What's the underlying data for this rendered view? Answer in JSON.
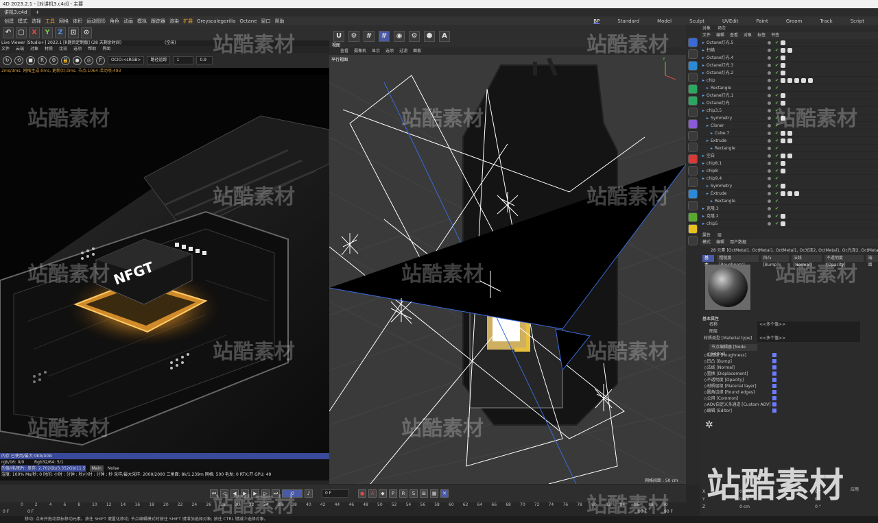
{
  "window": {
    "title": "4D 2023.2.1 - [对讲机3.c4d] - 主要"
  },
  "doc_tab": {
    "label": "讲机3.c4d",
    "plus": "+"
  },
  "menu": [
    "创建",
    "模式",
    "选择",
    "工具",
    "网格",
    "体积",
    "运动图形",
    "角色",
    "动画",
    "模拟",
    "跟踪器",
    "渲染",
    "扩展",
    "Greyscalegorilla",
    "Octane",
    "窗口",
    "帮助"
  ],
  "layouts": [
    "Standard",
    "Model",
    "Sculpt",
    "UVEdit",
    "Paint",
    "Groom",
    "Track",
    "Script"
  ],
  "active_layout": "BP",
  "axis_buttons": [
    "X",
    "Y",
    "Z"
  ],
  "live_viewer": {
    "title": "Live Viewer [Studio+] 2022.1 [R题目定制版] (28 天剩余时间)",
    "right": "(空闲)",
    "menu": [
      "文件",
      "云端",
      "对象",
      "材质",
      "比较",
      "选项",
      "帮助",
      "界面"
    ],
    "ocio": "OCIO:<sRGB>",
    "mode": "路径追踪",
    "val1": "1",
    "val2": "0.9",
    "stat": "2ms/3ms. 网格生成:0ms, 更新(t):0ms. 节点:1064 活动项:493",
    "chip_label": "NFGT"
  },
  "render_stats": {
    "line1": "内存 已使用/最大:0Kb/4Gb",
    "line2a": "rgb/16: 0/0",
    "line2b": "Rgb32/64: 5/1",
    "line3": "的值/排/图片: 显存: 2.702Gb/3.352Gb/11.5",
    "btn_main": "Main",
    "btn_noise": "Noise",
    "line4": "渲度: 100%  Ms/秒: 0  时间: 小时 : 分钟 : 秒/小时 : 分钟 : 秒  采样/最大采样: 2000/2000  三角面: 8k/1.239m  网格: 500  毛发: 0  RTX:开  GPU: 49"
  },
  "viewport": {
    "menu": [
      "查看",
      "摄像机",
      "显示",
      "选项",
      "过滤",
      "面板"
    ],
    "label": "视图",
    "view_name": "平行视图",
    "grid": "网格间距 : 50 cm"
  },
  "object_manager": {
    "tabs": [
      "对象",
      "场次"
    ],
    "menu": [
      "文件",
      "编辑",
      "查看",
      "对象",
      "标签",
      "书签"
    ],
    "objects": [
      {
        "name": "Octane灯光.5",
        "tags": 1
      },
      {
        "name": "扫描",
        "tags": 2
      },
      {
        "name": "Octane灯光.4",
        "tags": 1
      },
      {
        "name": "Octane灯光.3",
        "tags": 1
      },
      {
        "name": "Octane灯光.2",
        "tags": 1
      },
      {
        "name": "chip",
        "tags": 5
      },
      {
        "name": "Rectangle",
        "tags": 0
      },
      {
        "name": "Octane灯光.1",
        "tags": 1
      },
      {
        "name": "Octane灯光",
        "tags": 1
      },
      {
        "name": "chip3.5",
        "tags": 0
      },
      {
        "name": "Symmetry",
        "tags": 1
      },
      {
        "name": "Cloner",
        "tags": 0
      },
      {
        "name": "Cube.7",
        "tags": 2
      },
      {
        "name": "Extrude",
        "tags": 2
      },
      {
        "name": "Rectangle",
        "tags": 0
      },
      {
        "name": "空白",
        "tags": 2
      },
      {
        "name": "chip8.1",
        "tags": 1
      },
      {
        "name": "chip8",
        "tags": 1
      },
      {
        "name": "chip9.4",
        "tags": 0
      },
      {
        "name": "Symmetry",
        "tags": 1
      },
      {
        "name": "Extrude",
        "tags": 3
      },
      {
        "name": "Rectangle",
        "tags": 0
      },
      {
        "name": "克隆.3",
        "tags": 0
      },
      {
        "name": "克隆.2",
        "tags": 1
      },
      {
        "name": "chip5",
        "tags": 1
      }
    ]
  },
  "attributes": {
    "tabs": [
      "属性",
      "层"
    ],
    "menu": [
      "模式",
      "编辑",
      "用户数据"
    ],
    "header": "28 元素 [OctMetal1, OctMetal1, OctMetal1, Oc光泽2, OctMetal1, Oc光泽2, OctMetal1, OctMetal1, Oc光泽2,",
    "mat_tabs": [
      "基本",
      "粗糙度 [Roughness]",
      "凹凸 [Bump]",
      "法线 [Normal]",
      "不透明度 [Opacity]",
      "端面"
    ],
    "section": "基本属性",
    "name_label": "名称",
    "name_value": "<<多个值>>",
    "layer_label": "图层",
    "type_label": "材质类型 [Material type]",
    "type_value": "<<多个值>>",
    "node_editor": "节点编辑器 [Node Editor]",
    "channels": [
      "粗糙度 [Roughness]",
      "凹凸 [Bump]",
      "法线 [Normal]",
      "置换 [Displacement]",
      "不透明度 [Opacity]",
      "材质层级 [Material layer]",
      "圆角边缘 [Round edges]",
      "公用 [Common]",
      "AOV自定义多通道 [Custom AOV]",
      "编辑 [Editor]"
    ]
  },
  "coords": {
    "rows": [
      [
        "X",
        "0 cm",
        "0 °"
      ],
      [
        "Y",
        "0 cm",
        "0 °"
      ],
      [
        "Z",
        "0 cm",
        "0 °"
      ]
    ],
    "apply": "应用"
  },
  "timeline": {
    "frame": "0 F",
    "start": "0 F",
    "start2": "0 F",
    "end": "90 F",
    "end2": "90 F",
    "ticks": [
      "0",
      "2",
      "4",
      "6",
      "8",
      "10",
      "12",
      "14",
      "16",
      "18",
      "20",
      "22",
      "24",
      "26",
      "28",
      "30",
      "32",
      "34",
      "36",
      "38",
      "40",
      "42",
      "44",
      "46",
      "48",
      "50",
      "52",
      "54",
      "56",
      "58",
      "60",
      "62",
      "64",
      "66",
      "68",
      "70",
      "72",
      "74",
      "76",
      "78",
      "80",
      "82",
      "84",
      "86",
      "88",
      "90"
    ]
  },
  "status": {
    "text": "移动: 点击并拖动鼠标移动元素。按住 SHIFT 键量化移动; 节点编辑模式时按住 SHIFT 键增加选择对象; 按住 CTRL 键减少选择对象。"
  },
  "watermark": {
    "text": "站酷素材"
  },
  "colors": {
    "accent": "#f0a020",
    "selection": "#4a5aa8",
    "check": "#6fcf4f"
  }
}
